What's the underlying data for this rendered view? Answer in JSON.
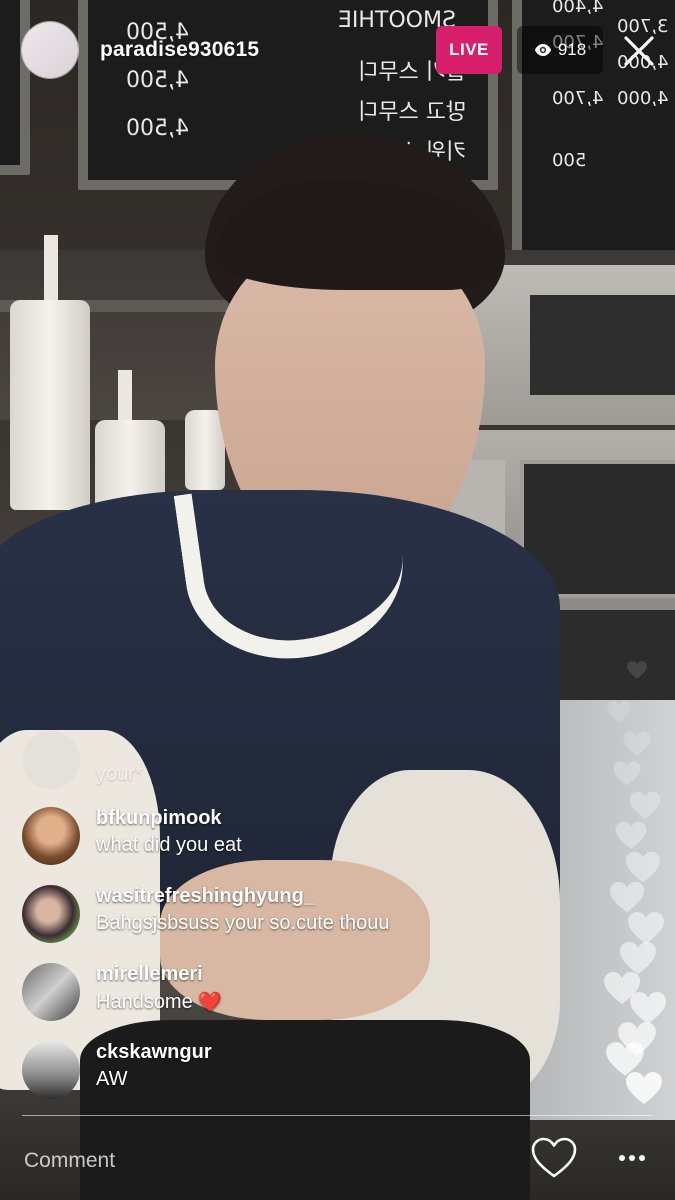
{
  "host": {
    "username": "paradise930615"
  },
  "live_badge": "LIVE",
  "viewers": {
    "icon": "eye-icon",
    "count": "918"
  },
  "menu_board": {
    "left_prices": [
      "4,500",
      "4,500",
      "4,500"
    ],
    "left_items": [
      "딸기 스무디",
      "망고 스무디",
      "키위 스무디"
    ],
    "left_title": "SMOOTHIE",
    "right_prices_a": [
      "3,700",
      "4,000",
      "4,000"
    ],
    "right_prices_b": [
      "4,400",
      "4,700",
      "4,700",
      "500"
    ]
  },
  "comments": [
    {
      "username": "",
      "text": "your*",
      "faded": true
    },
    {
      "username": "bfkunpimook",
      "text": "what did you eat"
    },
    {
      "username": "wasitrefreshinghyung_",
      "text": "Bahgsjsbsuss your so.cute thouu"
    },
    {
      "username": "mirellemeri",
      "text": "Handsome",
      "emoji": "❤️"
    },
    {
      "username": "ckskawngur",
      "text": "AW"
    }
  ],
  "footer": {
    "comment_placeholder": "Comment",
    "like_icon": "heart-outline-icon",
    "more_icon": "more-dots-icon"
  },
  "colors": {
    "live": "#d81f6c",
    "text": "#ffffff"
  }
}
